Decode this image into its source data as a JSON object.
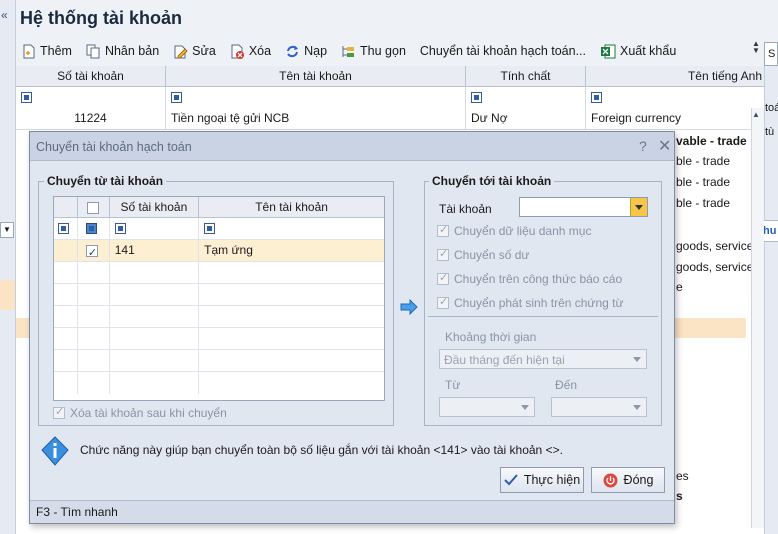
{
  "window": {
    "title": "Hệ thống tài khoản",
    "collapse_glyph": "«"
  },
  "toolbar": {
    "items": [
      {
        "label": "Thêm",
        "icon": "add-doc-icon"
      },
      {
        "label": "Nhân bản",
        "icon": "duplicate-icon"
      },
      {
        "label": "Sửa",
        "icon": "edit-icon"
      },
      {
        "label": "Xóa",
        "icon": "delete-icon"
      },
      {
        "label": "Nạp",
        "icon": "refresh-icon"
      },
      {
        "label": "Thu gọn",
        "icon": "collapse-tree-icon"
      },
      {
        "label": "Chuyển tài khoản hạch toán...",
        "icon": ""
      },
      {
        "label": "Xuất khẩu",
        "icon": "excel-icon"
      }
    ]
  },
  "grid": {
    "columns": [
      "Số tài khoản",
      "Tên tài khoản",
      "Tính chất",
      "Tên tiếng Anh"
    ],
    "first_row": {
      "account": "11224",
      "name": "Tiền ngoại tệ gửi NCB",
      "nature": "Dư Nợ",
      "english": "Foreign currency"
    },
    "right_fragments": [
      "vable - trade",
      "ble - trade",
      "ble - trade",
      "ble - trade",
      "goods, service",
      "goods, service",
      "e",
      "es",
      "s"
    ],
    "side_fragments": [
      "toá",
      "tù",
      "hu",
      "S"
    ]
  },
  "dialog": {
    "title": "Chuyển tài khoản hạch toán",
    "help_glyph": "?",
    "close_glyph": "✕",
    "from_group": {
      "label": "Chuyển từ tài khoản",
      "columns": [
        "Số tài khoản",
        "Tên tài khoản"
      ],
      "rows": [
        {
          "checked": true,
          "account": "141",
          "name": "Tạm ứng"
        }
      ],
      "delete_after_label": "Xóa tài khoản sau khi chuyển"
    },
    "to_group": {
      "label": "Chuyển tới tài khoản",
      "account_label": "Tài khoản",
      "account_value": "",
      "options": [
        "Chuyển dữ liệu danh mục",
        "Chuyển số dư",
        "Chuyển trên công thức báo cáo",
        "Chuyển phát sinh trên chứng từ"
      ],
      "period_label": "Khoảng thời gian",
      "period_value": "Đầu tháng đến hiện tại",
      "from_label": "Từ",
      "to_label": "Đến"
    },
    "info_text": "Chức năng này giúp bạn chuyển toàn bộ số liệu gắn với tài khoản <141> vào tài khoản <>.",
    "execute_button": "Thực hiện",
    "close_button": "Đóng",
    "status": "F3 - Tìm nhanh"
  }
}
